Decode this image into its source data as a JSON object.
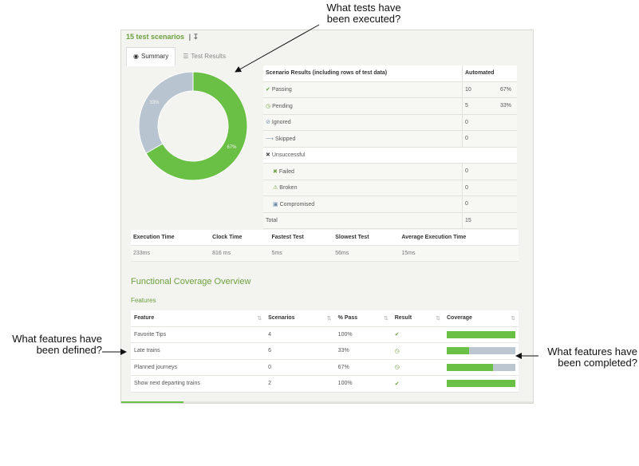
{
  "callouts": {
    "tests": [
      "What tests have",
      "been executed?"
    ],
    "features_defined": [
      "What features have",
      "been defined?"
    ],
    "features_completed": [
      "What features have",
      "been completed?"
    ]
  },
  "header": {
    "title": "15 test scenarios",
    "download_icon": "download-icon"
  },
  "tabs": [
    {
      "label": "Summary",
      "icon": "chart-icon",
      "active": true
    },
    {
      "label": "Test Results",
      "icon": "list-icon",
      "active": false
    }
  ],
  "chart_data": {
    "type": "pie",
    "categories": [
      "Passing",
      "Pending"
    ],
    "values": [
      10,
      5
    ],
    "labels": [
      "67%",
      "33%"
    ],
    "colors": [
      "#6abf45",
      "#b8c4cf"
    ],
    "donut": true
  },
  "scenario_results": {
    "header": "Scenario Results (including rows of test data)",
    "automated_label": "Automated",
    "rows": [
      {
        "label": "Passing",
        "icon": "check-circle-icon",
        "count": "10",
        "pct": "67%"
      },
      {
        "label": "Pending",
        "icon": "clock-icon",
        "count": "5",
        "pct": "33%"
      },
      {
        "label": "Ignored",
        "icon": "ban-icon",
        "count": "0",
        "pct": ""
      },
      {
        "label": "Skipped",
        "icon": "skip-icon",
        "count": "0",
        "pct": ""
      }
    ],
    "unsuccessful_label": "Unsuccessful",
    "sub_rows": [
      {
        "label": "Failed",
        "icon": "times-circle-icon",
        "count": "0"
      },
      {
        "label": "Broken",
        "icon": "warning-icon",
        "count": "0"
      },
      {
        "label": "Compromised",
        "icon": "lock-icon",
        "count": "0"
      }
    ],
    "total_label": "Total",
    "total": "15"
  },
  "execution": {
    "headers": [
      "Execution Time",
      "Clock Time",
      "Fastest Test",
      "Slowest Test",
      "Average Execution Time"
    ],
    "values": [
      "233ms",
      "816 ms",
      "5ms",
      "56ms",
      "15ms"
    ]
  },
  "coverage": {
    "title": "Functional Coverage Overview",
    "features_label": "Features",
    "headers": [
      "Feature",
      "Scenarios",
      "% Pass",
      "Result",
      "Coverage"
    ],
    "rows": [
      {
        "feature": "Favorite Tips",
        "scenarios": "4",
        "pass": "100%",
        "result": "check-circle-icon",
        "coverage": 1.0
      },
      {
        "feature": "Late trains",
        "scenarios": "6",
        "pass": "33%",
        "result": "clock-icon",
        "coverage": 0.33
      },
      {
        "feature": "Planned journeys",
        "scenarios": "0",
        "pass": "67%",
        "result": "clock-icon",
        "coverage": 0.67
      },
      {
        "feature": "Show next departing trains",
        "scenarios": "2",
        "pass": "100%",
        "result": "check-circle-icon",
        "coverage": 1.0
      }
    ]
  }
}
